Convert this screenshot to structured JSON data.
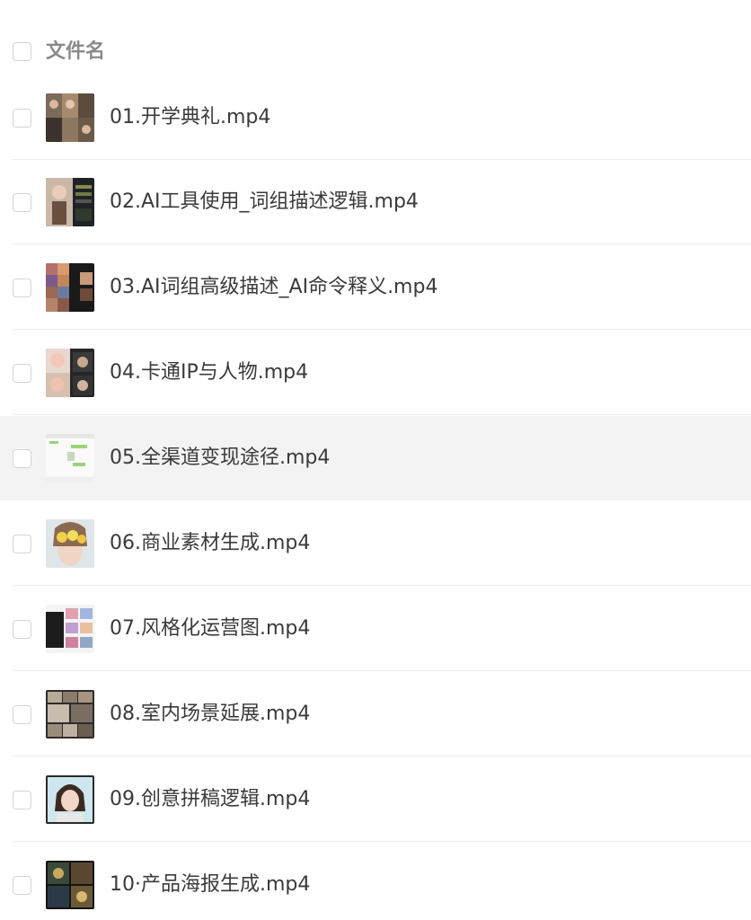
{
  "header": {
    "column_label": "文件名"
  },
  "files": [
    {
      "name": "01.开学典礼.mp4"
    },
    {
      "name": "02.AI工具使用_词组描述逻辑.mp4"
    },
    {
      "name": "03.AI词组高级描述_AI命令释义.mp4"
    },
    {
      "name": "04.卡通IP与人物.mp4"
    },
    {
      "name": "05.全渠道变现途径.mp4",
      "highlighted": true
    },
    {
      "name": "06.商业素材生成.mp4"
    },
    {
      "name": "07.风格化运营图.mp4"
    },
    {
      "name": "08.室内场景延展.mp4"
    },
    {
      "name": "09.创意拼稿逻辑.mp4"
    },
    {
      "name": "10·产品海报生成.mp4"
    }
  ],
  "thumbnail_icons": [
    "video-thumbnail-collage-icon",
    "video-thumbnail-portrait-icon",
    "video-thumbnail-grid-icon",
    "video-thumbnail-cartoon-icon",
    "video-thumbnail-chat-screenshot-icon",
    "video-thumbnail-portrait-flowers-icon",
    "video-thumbnail-web-layout-icon",
    "video-thumbnail-interior-icon",
    "video-thumbnail-portrait-blue-icon",
    "video-thumbnail-product-icon"
  ],
  "colors": {
    "highlight_row": "#f3f3f3",
    "divider": "#ececec",
    "text": "#3a3a3a",
    "header_text": "#8a8a8a"
  }
}
